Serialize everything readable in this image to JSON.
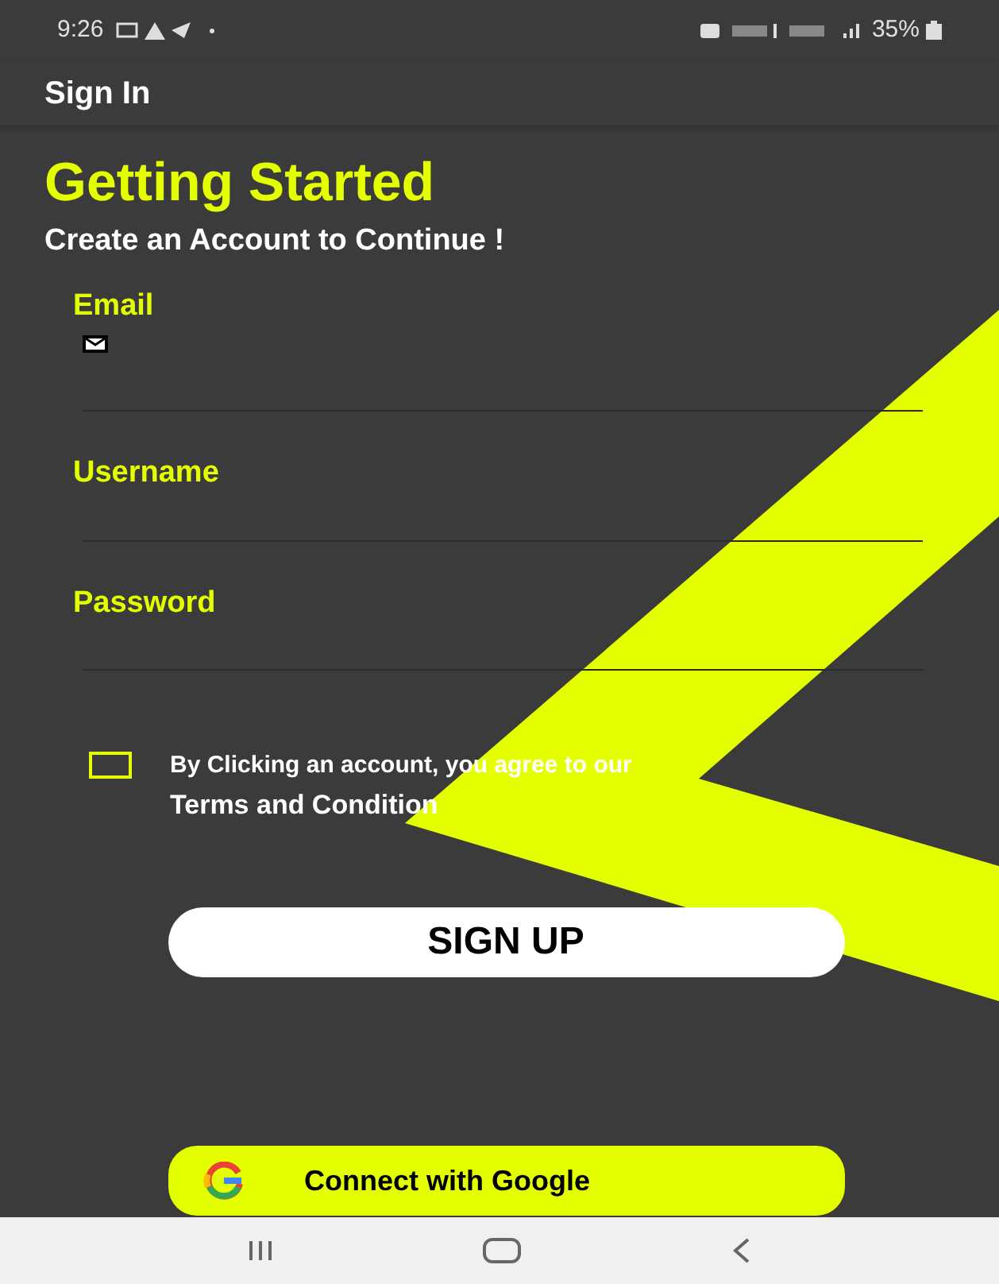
{
  "status_bar": {
    "time": "9:26",
    "battery": "35%"
  },
  "app_bar": {
    "title": "Sign In"
  },
  "heading": "Getting Started",
  "subheading": "Create an Account to Continue !",
  "fields": [
    {
      "label": "Email",
      "kind": "email"
    },
    {
      "label": "Username",
      "kind": "text"
    },
    {
      "label": "Password",
      "kind": "text"
    }
  ],
  "agreement": {
    "checked": false,
    "line_1": "By Clicking an account, you agree to our",
    "line_2": "Terms and Condition"
  },
  "signup_button": "SIGN UP",
  "google_button": "Connect with Google"
}
